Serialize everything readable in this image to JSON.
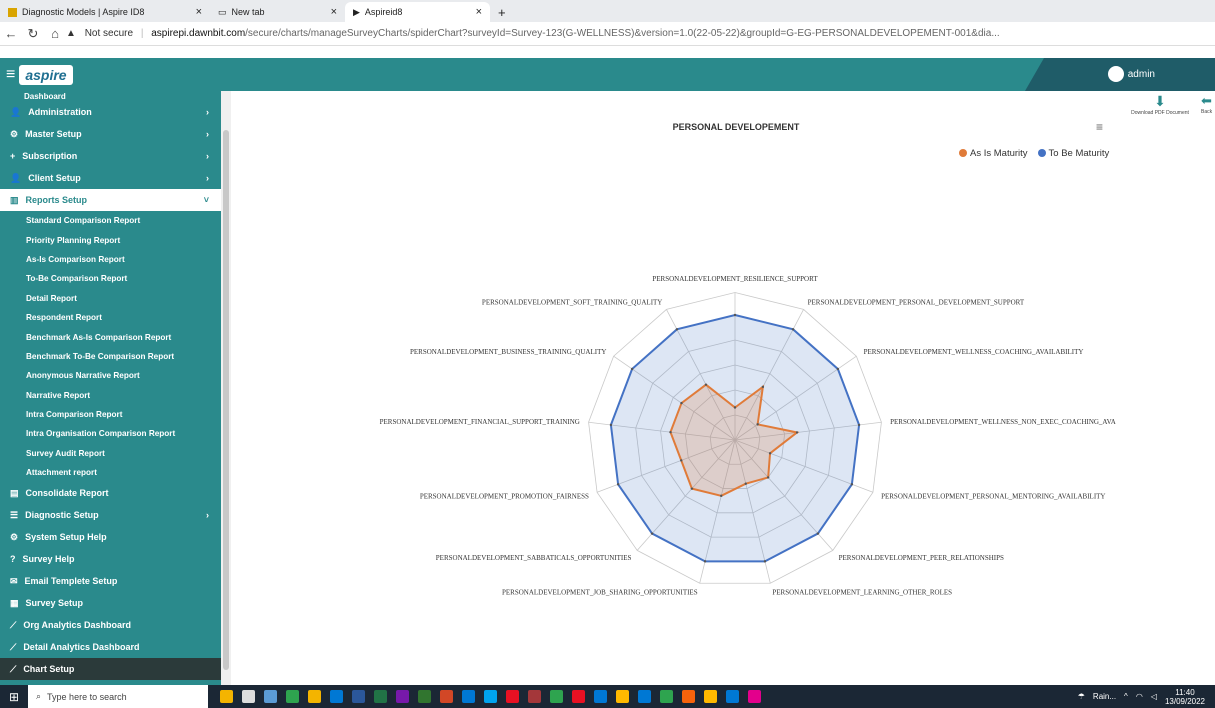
{
  "browser": {
    "tabs": [
      {
        "title": "Diagnostic Models | Aspire ID8"
      },
      {
        "title": "New tab"
      },
      {
        "title": "Aspireid8"
      }
    ],
    "not_secure": "Not secure",
    "url_domain": "aspirepi.dawnbit.com",
    "url_path": "/secure/charts/manageSurveyCharts/spiderChart?surveyId=Survey-123(G-WELLNESS)&version=1.0(22-05-22)&groupId=G-EG-PERSONALDEVELOPEMENT-001&dia..."
  },
  "header": {
    "brand": "aspire",
    "user": "admin"
  },
  "sidebar": {
    "top_partial": "Dashboard",
    "items": [
      {
        "label": "Administration",
        "icon": "user-icon",
        "chevron": "›"
      },
      {
        "label": "Master Setup",
        "icon": "gear-icon",
        "chevron": "›"
      },
      {
        "label": "Subscription",
        "icon": "plus-icon",
        "chevron": "›"
      },
      {
        "label": "Client Setup",
        "icon": "user-icon",
        "chevron": "›"
      }
    ],
    "reports": {
      "label": "Reports Setup",
      "icon": "bar-chart-icon",
      "chevron": "˅"
    },
    "report_items": [
      "Standard Comparison Report",
      "Priority Planning Report",
      "As-Is Comparison Report",
      "To-Be Comparison Report",
      "Detail Report",
      "Respondent Report",
      "Benchmark As-Is Comparison Report",
      "Benchmark To-Be Comparison Report",
      "Anonymous Narrative Report",
      "Narrative Report",
      "Intra Comparison Report",
      "Intra Organisation Comparison Report",
      "Survey Audit Report",
      "Attachment report"
    ],
    "bottom_items": [
      {
        "label": "Consolidate Report",
        "icon": "database-icon",
        "chevron": ""
      },
      {
        "label": "Diagnostic Setup",
        "icon": "list-icon",
        "chevron": "›"
      },
      {
        "label": "System Setup Help",
        "icon": "gear-icon",
        "chevron": ""
      },
      {
        "label": "Survey Help",
        "icon": "question-icon",
        "chevron": ""
      },
      {
        "label": "Email Templete Setup",
        "icon": "mail-icon",
        "chevron": ""
      },
      {
        "label": "Survey Setup",
        "icon": "survey-icon",
        "chevron": ""
      },
      {
        "label": "Org Analytics Dashboard",
        "icon": "line-chart-icon",
        "chevron": ""
      },
      {
        "label": "Detail Analytics Dashboard",
        "icon": "line-chart-icon",
        "chevron": ""
      }
    ],
    "chart_setup": {
      "label": "Chart Setup",
      "icon": "line-chart-icon"
    }
  },
  "toolbar": {
    "download_label": "Download PDF Document",
    "back_label": "Back"
  },
  "chart_data": {
    "type": "radar",
    "title": "PERSONAL DEVELOPEMENT",
    "legend_placement": "top-right",
    "axes": [
      "PERSONALDEVELOPMENT_RESILIENCE_SUPPORT",
      "PERSONALDEVELOPMENT_PERSONAL_DEVELOPMENT_SUPPORT",
      "PERSONALDEVELOPMENT_WELLNESS_COACHING_AVAILABILITY",
      "PERSONALDEVELOPMENT_WELLNESS_NON_EXEC_COACHING_AVA",
      "PERSONALDEVELOPMENT_PERSONAL_MENTORING_AVAILABILITY",
      "PERSONALDEVELOPMENT_PEER_RELATIONSHIPS",
      "PERSONALDEVELOPMENT_LEARNING_OTHER_ROLES",
      "PERSONALDEVELOPMENT_JOB_SHARING_OPPORTUNITIES",
      "PERSONALDEVELOPMENT_SABBATICALS_OPPORTUNITIES",
      "PERSONALDEVELOPMENT_PROMOTION_FAIRNESS",
      "PERSONALDEVELOPMENT_FINANCIAL_SUPPORT_TRAINING",
      "PERSONALDEVELOPMENT_BUSINESS_TRAINING_QUALITY",
      "PERSONALDEVELOPMENT_SOFT_TRAINING_QUALITY"
    ],
    "rmax": 5,
    "series": [
      {
        "name": "As Is Maturity",
        "color": "#e07b39",
        "values": [
          1.3,
          2.4,
          1.1,
          2.5,
          1.5,
          2.0,
          1.8,
          2.3,
          2.6,
          2.3,
          2.6,
          2.6,
          2.5
        ]
      },
      {
        "name": "To Be Maturity",
        "color": "#4472c4",
        "values": [
          5,
          5,
          5,
          5,
          5,
          5,
          5,
          5,
          5,
          5,
          5,
          5,
          5
        ]
      }
    ]
  },
  "taskbar": {
    "search_placeholder": "Type here to search",
    "weather": "Rain...",
    "time": "11:40",
    "date": "13/09/2022"
  }
}
